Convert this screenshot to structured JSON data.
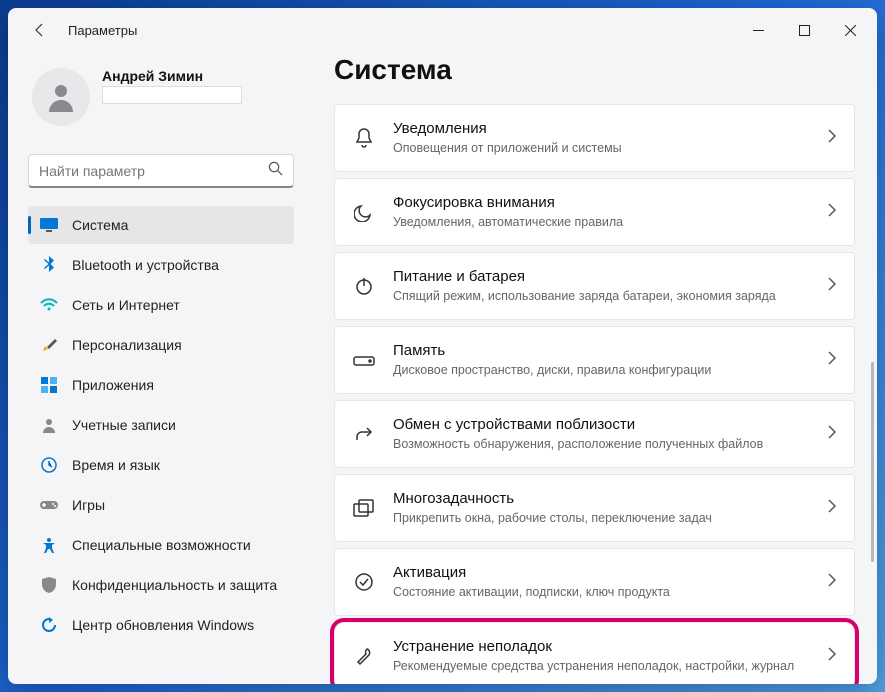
{
  "titlebar": {
    "title": "Параметры"
  },
  "profile": {
    "username": "Андрей Зимин"
  },
  "search": {
    "placeholder": "Найти параметр"
  },
  "nav": [
    {
      "label": "Система",
      "icon": "monitor",
      "active": true
    },
    {
      "label": "Bluetooth и устройства",
      "icon": "bluetooth",
      "active": false
    },
    {
      "label": "Сеть и Интернет",
      "icon": "wifi",
      "active": false
    },
    {
      "label": "Персонализация",
      "icon": "brush",
      "active": false
    },
    {
      "label": "Приложения",
      "icon": "apps",
      "active": false
    },
    {
      "label": "Учетные записи",
      "icon": "person",
      "active": false
    },
    {
      "label": "Время и язык",
      "icon": "clock",
      "active": false
    },
    {
      "label": "Игры",
      "icon": "game",
      "active": false
    },
    {
      "label": "Специальные возможности",
      "icon": "accessibility",
      "active": false
    },
    {
      "label": "Конфиденциальность и защита",
      "icon": "shield",
      "active": false
    },
    {
      "label": "Центр обновления Windows",
      "icon": "update",
      "active": false
    }
  ],
  "main": {
    "title": "Система",
    "cards": [
      {
        "icon": "bell",
        "title": "Уведомления",
        "sub": "Оповещения от приложений и системы",
        "highlight": false
      },
      {
        "icon": "moon",
        "title": "Фокусировка внимания",
        "sub": "Уведомления, автоматические правила",
        "highlight": false
      },
      {
        "icon": "power",
        "title": "Питание и батарея",
        "sub": "Спящий режим, использование заряда батареи, экономия заряда",
        "highlight": false
      },
      {
        "icon": "storage",
        "title": "Память",
        "sub": "Дисковое пространство, диски, правила конфигурации",
        "highlight": false
      },
      {
        "icon": "share",
        "title": "Обмен с устройствами поблизости",
        "sub": "Возможность обнаружения, расположение полученных файлов",
        "highlight": false
      },
      {
        "icon": "multi",
        "title": "Многозадачность",
        "sub": "Прикрепить окна, рабочие столы, переключение задач",
        "highlight": false
      },
      {
        "icon": "check",
        "title": "Активация",
        "sub": "Состояние активации, подписки, ключ продукта",
        "highlight": false
      },
      {
        "icon": "wrench",
        "title": "Устранение неполадок",
        "sub": "Рекомендуемые средства устранения неполадок, настройки, журнал",
        "highlight": true
      }
    ]
  }
}
